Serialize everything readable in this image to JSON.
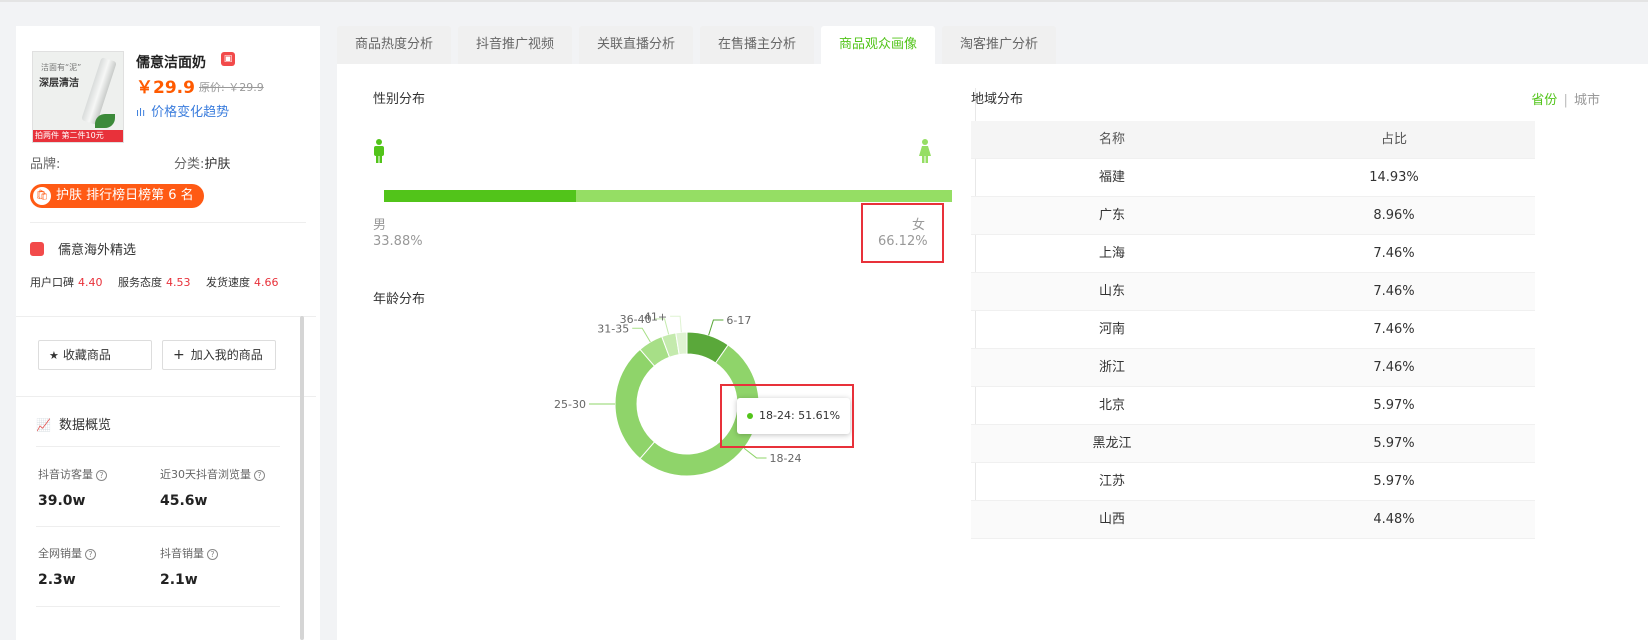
{
  "product": {
    "name": "儒意洁面奶",
    "price": "￥29.9",
    "original_price": "原价: ￥29.9",
    "price_trend_label": "价格变化趋势",
    "brand_label": "品牌:",
    "category_label": "分类:",
    "category_value": "护肤",
    "rank_text": "护肤 排行榜日榜第 6 名",
    "image_text_top": "洁面有“泥”",
    "image_text_main": "深层清洁",
    "image_footer": "拍两件 第二件10元"
  },
  "shop": {
    "name": "儒意海外精选",
    "scores": [
      {
        "label": "用户口碑",
        "value": "4.40"
      },
      {
        "label": "服务态度",
        "value": "4.53"
      },
      {
        "label": "发货速度",
        "value": "4.66"
      }
    ]
  },
  "actions": {
    "favorite": "收藏商品",
    "add_mine": "加入我的商品"
  },
  "overview": {
    "title": "数据概览",
    "metrics": [
      {
        "label": "抖音访客量",
        "value": "39.0w"
      },
      {
        "label": "近30天抖音浏览量",
        "value": "45.6w"
      },
      {
        "label": "全网销量",
        "value": "2.3w"
      },
      {
        "label": "抖音销量",
        "value": "2.1w"
      }
    ]
  },
  "tabs": [
    "商品热度分析",
    "抖音推广视频",
    "关联直播分析",
    "在售播主分析",
    "商品观众画像",
    "淘客推广分析"
  ],
  "active_tab": 4,
  "gender": {
    "title": "性别分布",
    "male_label": "男",
    "male_pct": "33.88%",
    "female_label": "女",
    "female_pct": "66.12%",
    "male_fraction": 0.3388
  },
  "age": {
    "title": "年龄分布",
    "tooltip": "18-24: 51.61%"
  },
  "chart_data": {
    "type": "pie",
    "categories": [
      "6-17",
      "18-24",
      "25-30",
      "31-35",
      "36-40",
      "41+"
    ],
    "values": [
      9.7,
      51.61,
      27.4,
      5.6,
      3.2,
      2.5
    ],
    "colors": [
      "#5aa83a",
      "#8fd46a",
      "#8fd46a",
      "#a7df87",
      "#c4eaad",
      "#dff3d2"
    ]
  },
  "region": {
    "title": "地域分布",
    "toggle_province": "省份",
    "toggle_sep": "|",
    "toggle_city": "城市",
    "columns": [
      "名称",
      "占比"
    ],
    "rows": [
      [
        "福建",
        "14.93%"
      ],
      [
        "广东",
        "8.96%"
      ],
      [
        "上海",
        "7.46%"
      ],
      [
        "山东",
        "7.46%"
      ],
      [
        "河南",
        "7.46%"
      ],
      [
        "浙江",
        "7.46%"
      ],
      [
        "北京",
        "5.97%"
      ],
      [
        "黑龙江",
        "5.97%"
      ],
      [
        "江苏",
        "5.97%"
      ],
      [
        "山西",
        "4.48%"
      ]
    ]
  }
}
